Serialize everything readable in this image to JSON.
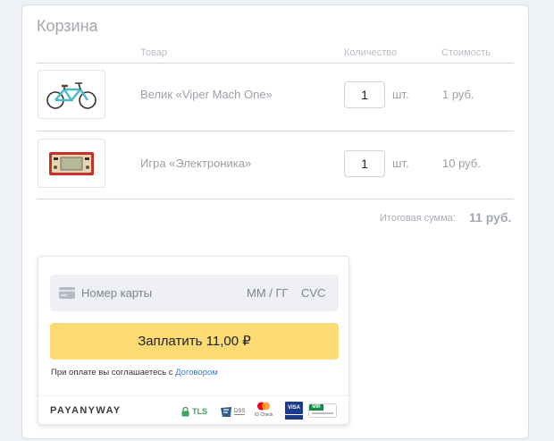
{
  "cart": {
    "title": "Корзина",
    "headers": {
      "product": "Товар",
      "quantity": "Количество",
      "cost": "Стоимость"
    },
    "items": [
      {
        "name": "Велик «Viper Mach One»",
        "quantity": "1",
        "unit": "шт.",
        "price": "1 руб.",
        "image_icon": "bicycle-icon"
      },
      {
        "name": "Игра «Электроника»",
        "quantity": "1",
        "unit": "шт.",
        "price": "10 руб.",
        "image_icon": "handheld-game-icon"
      }
    ],
    "total_label": "Итоговая сумма:",
    "total_value": "11 руб."
  },
  "payment": {
    "card_number_placeholder": "Номер карты",
    "expiry_placeholder": "ММ / ГГ",
    "cvc_placeholder": "CVC",
    "pay_button": "Заплатить 11,00 ₽",
    "agreement_text": "При оплате вы соглашаетесь с ",
    "agreement_link": "Договором",
    "brand": "PAYANYWAY",
    "badges": {
      "tls": "TLS",
      "pci": "DSS",
      "idcheck": "ID Check",
      "visa": "VISA",
      "mir": "MIR"
    }
  },
  "colors": {
    "pay_button": "#fcda74",
    "link": "#3a7bc8",
    "bike_frame": "#4bb8c8"
  }
}
